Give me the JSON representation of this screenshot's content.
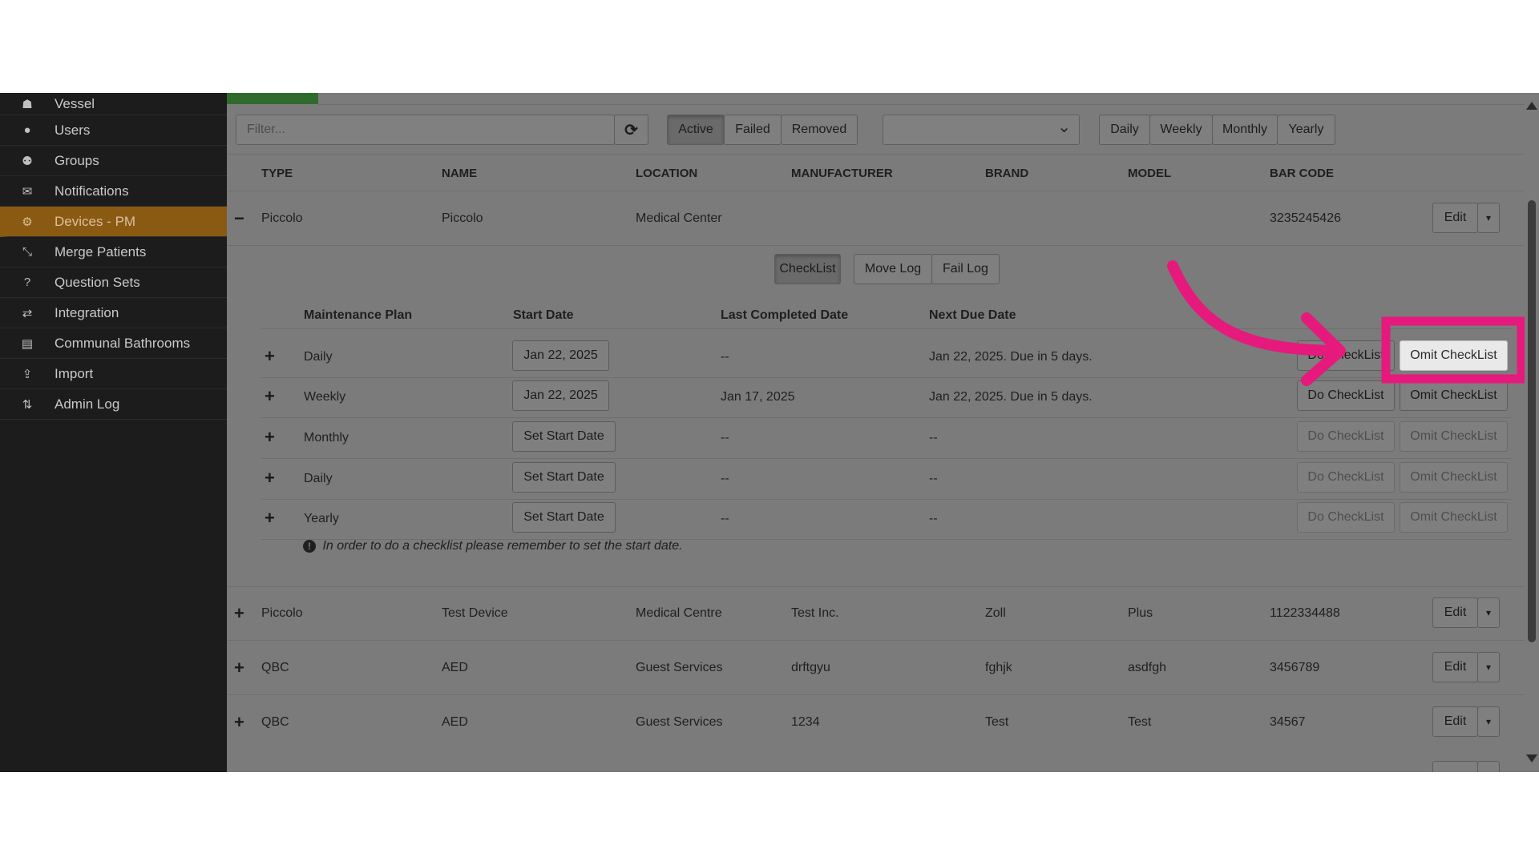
{
  "sidebar": {
    "items": [
      {
        "label": "Vessel",
        "icon": "vessel-icon",
        "glyph": "☗"
      },
      {
        "label": "Users",
        "icon": "user-icon",
        "glyph": "●"
      },
      {
        "label": "Groups",
        "icon": "groups-icon",
        "glyph": "⚉"
      },
      {
        "label": "Notifications",
        "icon": "envelope-icon",
        "glyph": "✉"
      },
      {
        "label": "Devices - PM",
        "icon": "cogs-icon",
        "glyph": "⚙",
        "active": true
      },
      {
        "label": "Merge Patients",
        "icon": "compress-icon",
        "glyph": "⤡"
      },
      {
        "label": "Question Sets",
        "icon": "question-icon",
        "glyph": "?"
      },
      {
        "label": "Integration",
        "icon": "exchange-icon",
        "glyph": "⇄"
      },
      {
        "label": "Communal Bathrooms",
        "icon": "card-icon",
        "glyph": "▤"
      },
      {
        "label": "Import",
        "icon": "upload-icon",
        "glyph": "⇪"
      },
      {
        "label": "Admin Log",
        "icon": "sort-icon",
        "glyph": "⇅"
      }
    ]
  },
  "toolbar": {
    "filter_placeholder": "Filter...",
    "refresh_glyph": "⟳",
    "status_tabs": [
      "Active",
      "Failed",
      "Removed"
    ],
    "period_tabs": [
      "Daily",
      "Weekly",
      "Monthly",
      "Yearly"
    ],
    "select_value": "",
    "select_glyph": "⌄"
  },
  "table": {
    "headers": [
      "TYPE",
      "NAME",
      "LOCATION",
      "MANUFACTURER",
      "BRAND",
      "MODEL",
      "BAR CODE"
    ],
    "edit_label": "Edit",
    "caret": "▾",
    "expanded_row": {
      "toggle": "−",
      "type": "Piccolo",
      "name": "Piccolo",
      "location": "Medical Center",
      "manufacturer": "",
      "brand": "",
      "model": "",
      "barcode": "3235245426"
    },
    "rows": [
      {
        "toggle": "+",
        "type": "Piccolo",
        "name": "Test Device",
        "location": "Medical Centre",
        "manufacturer": "Test Inc.",
        "brand": "Zoll",
        "model": "Plus",
        "barcode": "1122334488"
      },
      {
        "toggle": "+",
        "type": "QBC",
        "name": "AED",
        "location": "Guest Services",
        "manufacturer": "drftgyu",
        "brand": "fghjk",
        "model": "asdfgh",
        "barcode": "3456789"
      },
      {
        "toggle": "+",
        "type": "QBC",
        "name": "AED",
        "location": "Guest Services",
        "manufacturer": "1234",
        "brand": "Test",
        "model": "Test",
        "barcode": "34567"
      }
    ]
  },
  "detail": {
    "tabs": [
      "CheckList",
      "Move Log",
      "Fail Log"
    ],
    "headers": [
      "Maintenance Plan",
      "Start Date",
      "Last Completed Date",
      "Next Due Date"
    ],
    "do_label": "Do CheckList",
    "omit_label": "Omit CheckList",
    "plans": [
      {
        "plan": "Daily",
        "start": "Jan 22, 2025",
        "last": "--",
        "next": "Jan 22, 2025. Due in 5 days."
      },
      {
        "plan": "Weekly",
        "start": "Jan 22, 2025",
        "last": "Jan 17, 2025",
        "next": "Jan 22, 2025. Due in 5 days."
      },
      {
        "plan": "Monthly",
        "start": "Set Start Date",
        "last": "--",
        "next": "--"
      },
      {
        "plan": "Daily",
        "start": "Set Start Date",
        "last": "--",
        "next": "--"
      },
      {
        "plan": "Yearly",
        "start": "Set Start Date",
        "last": "--",
        "next": "--"
      }
    ],
    "note_glyph": "!",
    "note": "In order to do a checklist please remember to set the start date."
  },
  "annotation": {
    "color": "#e6197c"
  }
}
